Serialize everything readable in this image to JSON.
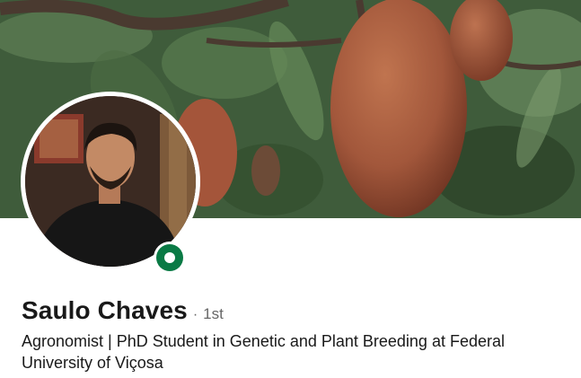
{
  "profile": {
    "name": "Saulo Chaves",
    "separator": "·",
    "connection_degree": "1st",
    "headline": "Agronomist | PhD Student in Genetic and Plant Breeding at Federal University of Viçosa"
  },
  "status": {
    "color": "#0a7a45"
  },
  "colors": {
    "cover_dark_green": "#2f4a2e",
    "fruit_brown": "#a4553a",
    "text_primary": "#1a1a1a",
    "text_secondary": "#666666"
  }
}
